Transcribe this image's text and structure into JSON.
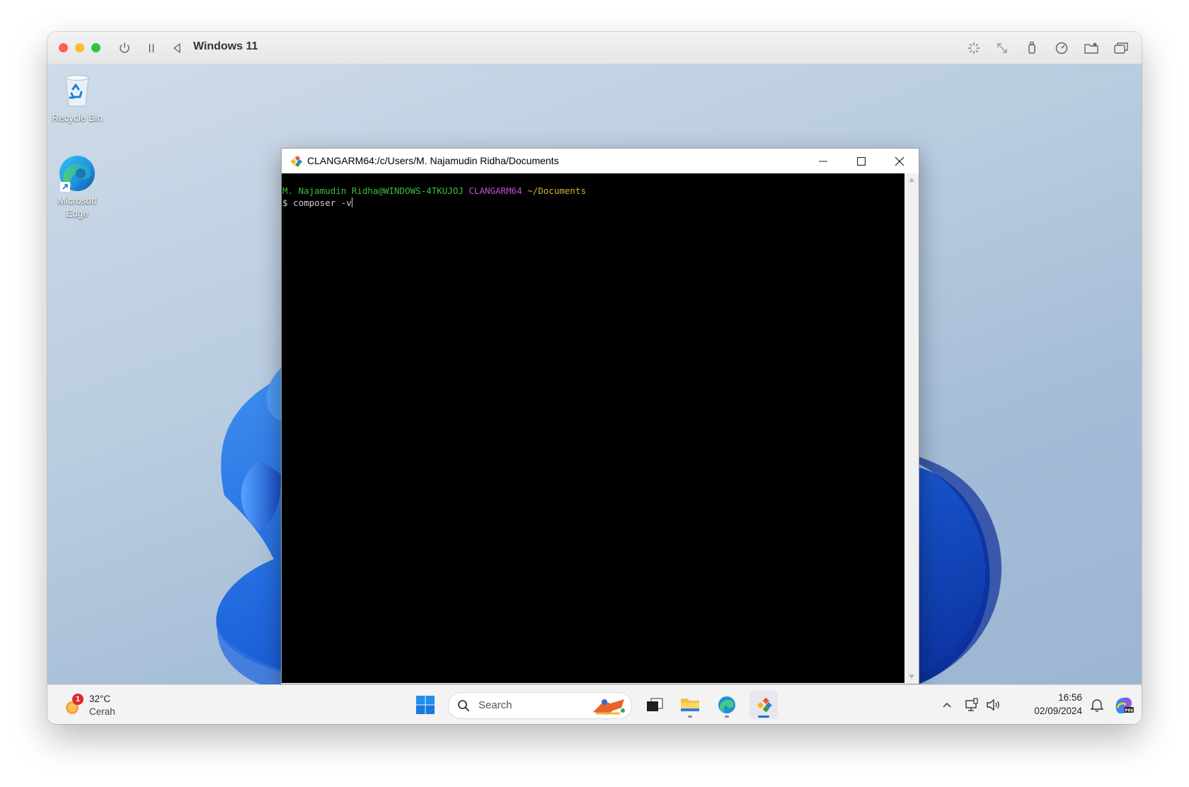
{
  "vm": {
    "title": "Windows 11"
  },
  "desktop": {
    "icons": [
      {
        "label": "Recycle Bin"
      },
      {
        "label_line1": "Microsoft",
        "label_line2": "Edge"
      }
    ]
  },
  "terminal": {
    "title": "CLANGARM64:/c/Users/M. Najamudin Ridha/Documents",
    "prompt": {
      "user_host": "M. Najamudin Ridha@WINDOWS-4TKUJOJ",
      "env": "CLANGARM64",
      "path": "~/Documents"
    },
    "command_line": "$ composer -v",
    "colors": {
      "user_host": "#3bbf3b",
      "env": "#c24fd6",
      "path": "#d6b23b",
      "text": "#d0d0d0"
    }
  },
  "taskbar": {
    "weather": {
      "temp": "32°C",
      "condition": "Cerah",
      "badge": "1"
    },
    "search_placeholder": "Search",
    "clock": {
      "time": "16:56",
      "date": "02/09/2024"
    }
  },
  "icons": {
    "mac_toolbar": [
      "power-icon",
      "pause-icon",
      "back-icon",
      "brightness-icon",
      "resize-icon",
      "usb-icon",
      "gauge-icon",
      "shared-folder-icon",
      "windows-icon"
    ],
    "tray": [
      "chevron-up-icon",
      "network-icon",
      "volume-icon",
      "bell-icon",
      "copilot-icon"
    ]
  }
}
